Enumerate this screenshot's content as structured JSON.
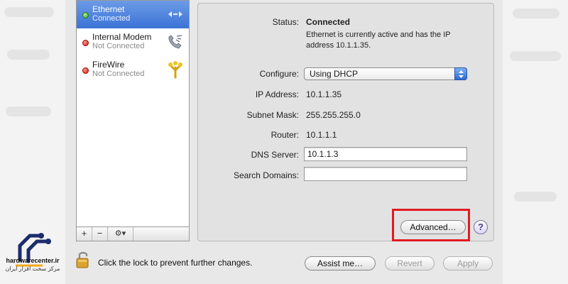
{
  "services": [
    {
      "name": "Ethernet",
      "status": "Connected",
      "indicator": "green",
      "icon": "ethernet-arrows-icon",
      "selected": true
    },
    {
      "name": "Internal Modem",
      "status": "Not Connected",
      "indicator": "red",
      "icon": "phone-modem-icon",
      "selected": false
    },
    {
      "name": "FireWire",
      "status": "Not Connected",
      "indicator": "red",
      "icon": "firewire-trident-icon",
      "selected": false
    }
  ],
  "list_toolbar": {
    "add_label": "+",
    "remove_label": "−",
    "action_label": "⚙▾"
  },
  "detail": {
    "status_label": "Status:",
    "status_value": "Connected",
    "status_description": "Ethernet is currently active and has the IP address 10.1.1.35.",
    "configure_label": "Configure:",
    "configure_value": "Using DHCP",
    "ip_label": "IP Address:",
    "ip_value": "10.1.1.35",
    "subnet_label": "Subnet Mask:",
    "subnet_value": "255.255.255.0",
    "router_label": "Router:",
    "router_value": "10.1.1.1",
    "dns_label": "DNS Server:",
    "dns_value": "10.1.1.3",
    "search_label": "Search Domains:",
    "search_value": "",
    "advanced_label": "Advanced…",
    "help_label": "?"
  },
  "footer": {
    "lock_text": "Click the lock to prevent further changes.",
    "assist_label": "Assist me…",
    "revert_label": "Revert",
    "apply_label": "Apply"
  },
  "watermark": {
    "brand": "hardwarecenter.ir",
    "tagline": "مرکز سخت افزار ایران"
  },
  "colors": {
    "selection": "#3b74d6",
    "highlight": "#e11b22",
    "connected": "#2e9b1a",
    "disconnected": "#c8170c"
  }
}
